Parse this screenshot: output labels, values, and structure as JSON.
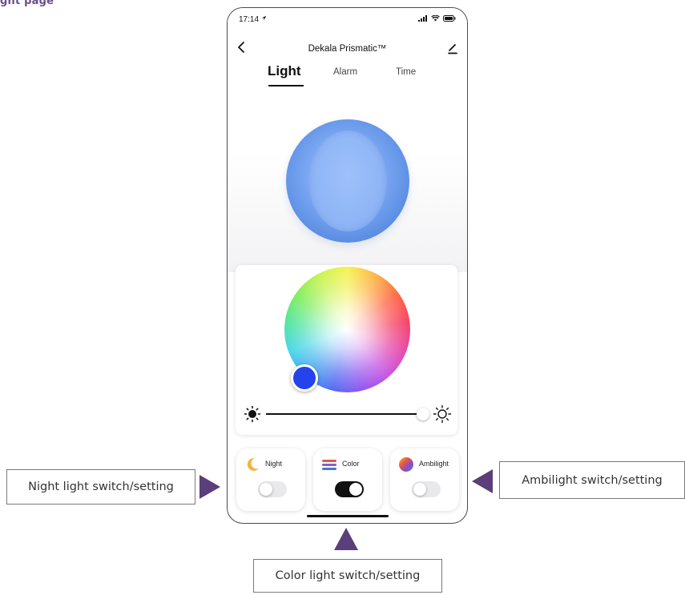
{
  "page_heading": "ght page",
  "status_bar": {
    "time": "17:14"
  },
  "nav": {
    "title": "Dekala Prismatic™"
  },
  "tabs": [
    {
      "label": "Light",
      "active": true
    },
    {
      "label": "Alarm",
      "active": false
    },
    {
      "label": "Time",
      "active": false
    }
  ],
  "light": {
    "sphere_color": "#7ba8f2",
    "selected_color": "#2443ec",
    "brightness_percent": 90
  },
  "modes": [
    {
      "label": "Night",
      "icon": "moon-icon",
      "enabled": false
    },
    {
      "label": "Color",
      "icon": "color-bars-icon",
      "enabled": true
    },
    {
      "label": "Ambilight",
      "icon": "ambilight-icon",
      "enabled": false
    }
  ],
  "callouts": {
    "night": "Night light switch/setting",
    "ambilight": "Ambilight switch/setting",
    "color": "Color light switch/setting"
  },
  "colors": {
    "accent_purple": "#5a3f7a",
    "heading_purple": "#6b4a8c"
  }
}
